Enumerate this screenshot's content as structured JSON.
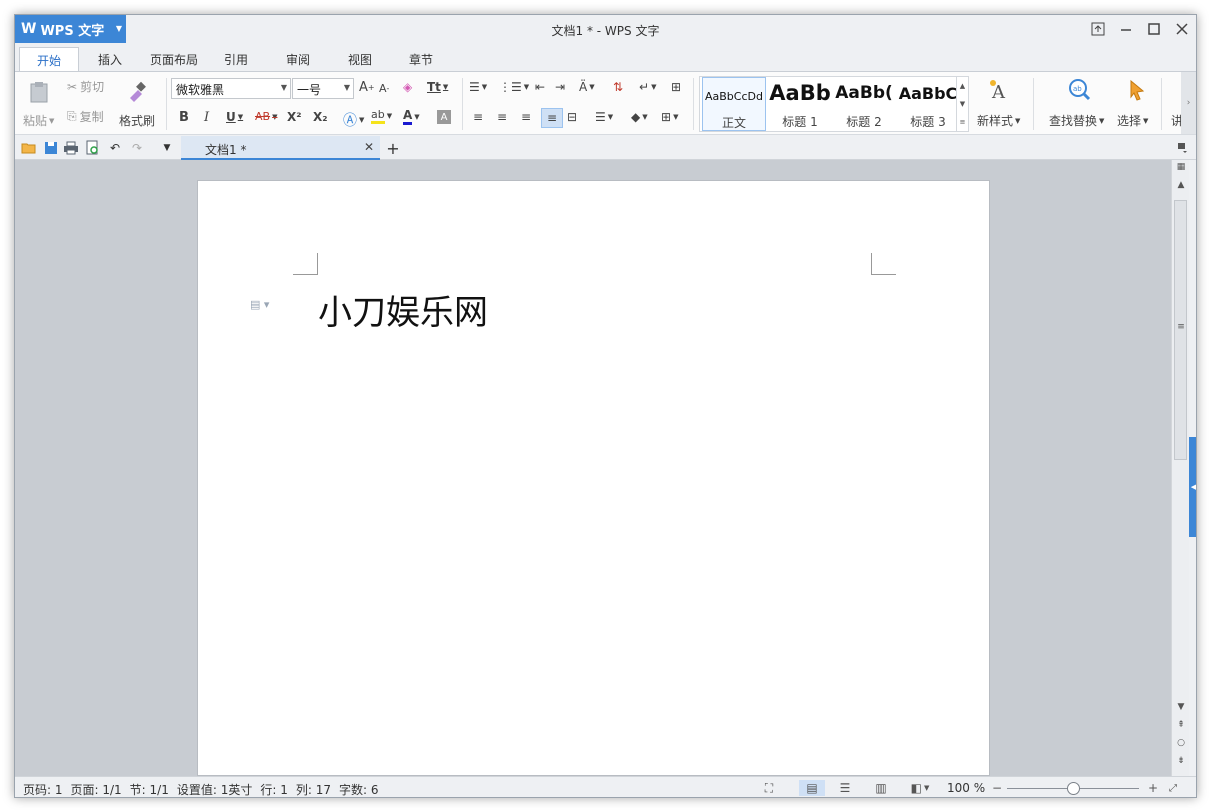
{
  "app": {
    "name": "WPS 文字",
    "logo": "W"
  },
  "window": {
    "title": "文档1 * - WPS 文字",
    "controls": [
      "restore-toolbar-icon",
      "minimize-icon",
      "maximize-icon",
      "close-icon"
    ]
  },
  "menu_tabs": [
    "开始",
    "插入",
    "页面布局",
    "引用",
    "审阅",
    "视图",
    "章节"
  ],
  "active_tab": "开始",
  "clipboard": {
    "paste": "粘贴",
    "cut": "剪切",
    "copy": "复制",
    "format_painter": "格式刷"
  },
  "font": {
    "name": "微软雅黑",
    "size": "一号"
  },
  "font_buttons": {
    "bold": "B",
    "italic": "I",
    "underline": "U",
    "strike": "AB",
    "superscript": "X²",
    "subscript": "X₂",
    "font_color": "A",
    "grow": "A⁺",
    "shrink": "A⁻",
    "case": "Tt"
  },
  "styles": [
    {
      "preview": "AaBbCcDd",
      "name": "正文"
    },
    {
      "preview": "AaBb",
      "name": "标题 1"
    },
    {
      "preview": "AaBb(",
      "name": "标题 2"
    },
    {
      "preview": "AaBbC",
      "name": "标题 3"
    }
  ],
  "ribbon_actions": {
    "new_style": "新样式",
    "find_replace": "查找替换",
    "select": "选择",
    "more": "讲"
  },
  "doc_tab": {
    "name": "文档1 *"
  },
  "document": {
    "text": "小刀娱乐网"
  },
  "status": {
    "page_num": "页码: 1",
    "pages": "页面: 1/1",
    "section": "节: 1/1",
    "setting": "设置值: 1英寸",
    "row": "行: 1",
    "col": "列: 17",
    "word_count": "字数: 6"
  },
  "zoom": {
    "label": "100 %",
    "level": 0.5
  },
  "colors": {
    "accent": "#3c86d6",
    "workspace": "#c8ccd2"
  }
}
